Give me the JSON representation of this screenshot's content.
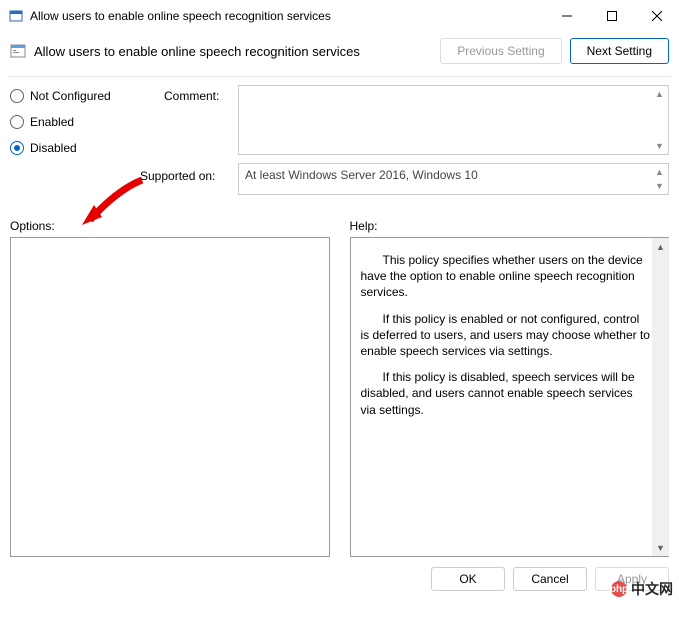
{
  "window": {
    "title": "Allow users to enable online speech recognition services"
  },
  "subheader": {
    "title": "Allow users to enable online speech recognition services"
  },
  "nav": {
    "previous": "Previous Setting",
    "next": "Next Setting"
  },
  "radios": {
    "not_configured": "Not Configured",
    "enabled": "Enabled",
    "disabled": "Disabled",
    "selected": "disabled"
  },
  "labels": {
    "comment": "Comment:",
    "supported_on": "Supported on:",
    "options": "Options:",
    "help": "Help:"
  },
  "fields": {
    "comment": "",
    "supported_on": "At least Windows Server 2016, Windows 10"
  },
  "help": {
    "p1": "This policy specifies whether users on the device have the option to enable online speech recognition services.",
    "p2": "If this policy is enabled or not configured, control is deferred to users, and users may choose whether to enable speech services via settings.",
    "p3": "If this policy is disabled, speech services will be disabled, and users cannot enable speech services via settings."
  },
  "footer": {
    "ok": "OK",
    "cancel": "Cancel",
    "apply": "Apply"
  },
  "watermark": {
    "text": " 中文网",
    "brand": "php"
  }
}
